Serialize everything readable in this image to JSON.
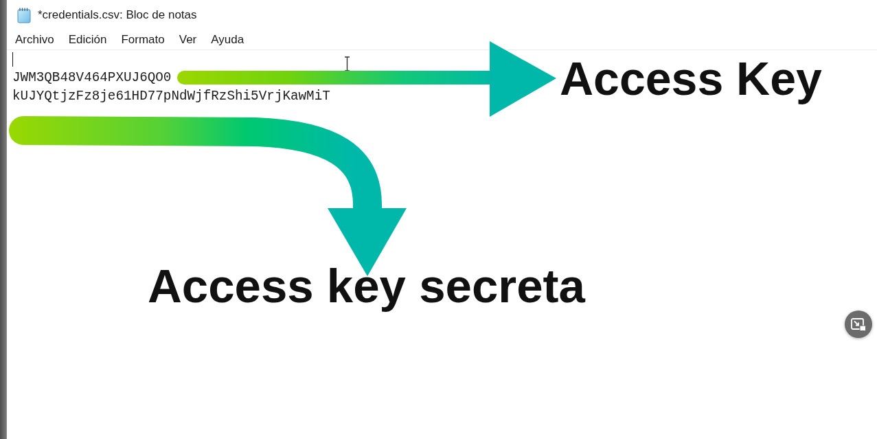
{
  "window": {
    "title": "*credentials.csv: Bloc de notas"
  },
  "menu_bar": [
    "Archivo",
    "Edición",
    "Formato",
    "Ver",
    "Ayuda"
  ],
  "editor": {
    "lines": [
      "JWM3QB48V464PXUJ6QO0",
      "kUJYQtjzFz8je61HD77pNdWjfRzShi5VrjKawMiT"
    ]
  },
  "annotations": [
    {
      "kind": "straight",
      "label": "Access Key"
    },
    {
      "kind": "curved",
      "label": "Access key secreta"
    }
  ]
}
